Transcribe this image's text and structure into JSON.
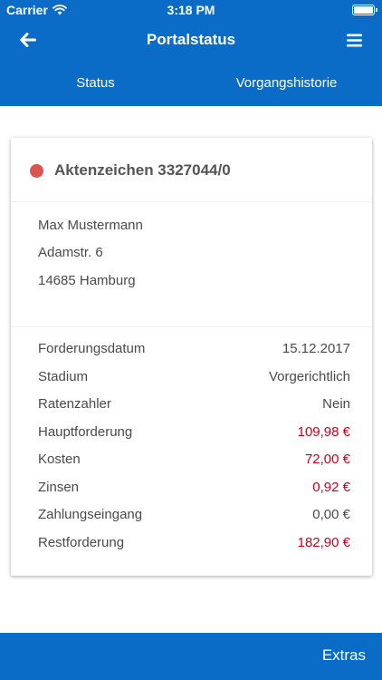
{
  "status_bar": {
    "carrier": "Carrier",
    "time": "3:18 PM"
  },
  "nav": {
    "title": "Portalstatus"
  },
  "tabs": [
    {
      "label": "Status"
    },
    {
      "label": "Vorgangshistorie"
    }
  ],
  "case": {
    "title": "Aktenzeichen 3327044/0",
    "status_color": "#d9534f",
    "address": [
      "Max Mustermann",
      "Adamstr. 6",
      "14685 Hamburg"
    ],
    "details": [
      {
        "label": "Forderungsdatum",
        "value": "15.12.2017",
        "highlight": false
      },
      {
        "label": "Stadium",
        "value": "Vorgerichtlich",
        "highlight": false
      },
      {
        "label": "Ratenzahler",
        "value": "Nein",
        "highlight": false
      },
      {
        "label": "Hauptforderung",
        "value": "109,98 €",
        "highlight": true
      },
      {
        "label": "Kosten",
        "value": "72,00 €",
        "highlight": true
      },
      {
        "label": "Zinsen",
        "value": "0,92 €",
        "highlight": true
      },
      {
        "label": "Zahlungseingang",
        "value": "0,00 €",
        "highlight": false
      },
      {
        "label": "Restforderung",
        "value": "182,90 €",
        "highlight": true
      }
    ]
  },
  "footer": {
    "extras_label": "Extras"
  },
  "colors": {
    "primary": "#0b6cc7",
    "highlight": "#c9001b"
  }
}
